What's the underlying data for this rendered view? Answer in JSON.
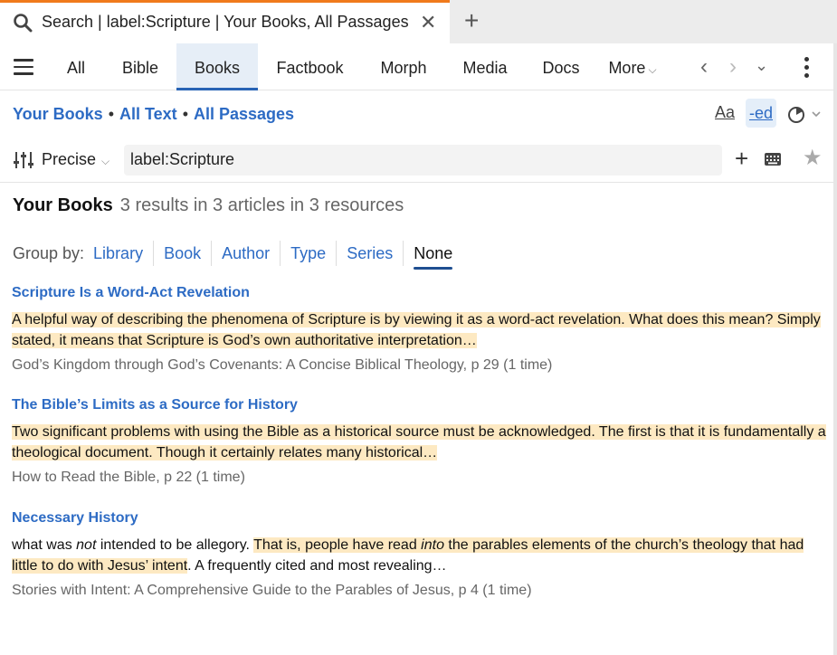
{
  "tab": {
    "title": "Search | label:Scripture | Your Books, All Passages",
    "close_glyph": "✕",
    "new_tab_glyph": "+",
    "accent": "#f07a1c"
  },
  "nav": {
    "tabs": [
      "All",
      "Bible",
      "Books",
      "Factbook",
      "Morph",
      "Media",
      "Docs"
    ],
    "active_tab": "Books",
    "more_label": "More",
    "back_glyph": "‹",
    "forward_glyph": "›",
    "history_glyph": "⌄"
  },
  "scope": {
    "collection": "Your Books",
    "text_scope": "All Text",
    "passage_scope": "All Passages",
    "font_tool": "Aa",
    "edit_tool": "-ed"
  },
  "search": {
    "mode": "Precise",
    "query": "label:Scripture",
    "add_glyph": "+",
    "star_glyph": "★"
  },
  "results": {
    "heading": "Your Books",
    "summary": "3 results in 3 articles in 3 resources",
    "group_by_label": "Group by:",
    "group_options": [
      "Library",
      "Book",
      "Author",
      "Type",
      "Series",
      "None"
    ],
    "group_active": "None",
    "items": [
      {
        "title": "Scripture Is a Word-Act Revelation",
        "snippet_hl": "A helpful way of describing the phenomena of Scripture is by viewing it as a word-act revelation. What does this mean? Simply stated, it means that Scripture is God’s own authoritative interpretation…",
        "source": "God’s Kingdom through God’s Covenants: A Concise Biblical Theology, p 29 (1 time)"
      },
      {
        "title": "The Bible’s Limits as a Source for History",
        "snippet_hl": "Two significant problems with using the Bible as a historical source must be acknowledged. The first is that it is fundamentally a theological document. Though it certainly relates many historical…",
        "source": "How to Read the Bible, p 22 (1 time)"
      },
      {
        "title": "Necessary History",
        "snippet_pre1": "what was ",
        "snippet_em1": "not",
        "snippet_pre2": " intended to be allegory. ",
        "snippet_hl1": "That is, people have read ",
        "snippet_hl_em": "into",
        "snippet_hl2": " the parables elements of the church’s theology that had little to do with Jesus’ intent",
        "snippet_post": ". A frequently cited and most revealing…",
        "source": "Stories with Intent: A Comprehensive Guide to the Parables of Jesus, p 4 (1 time)"
      }
    ]
  },
  "colors": {
    "link": "#2d6bc4",
    "highlight": "#fde9c2",
    "active_tab_bg": "#e6eef7"
  }
}
